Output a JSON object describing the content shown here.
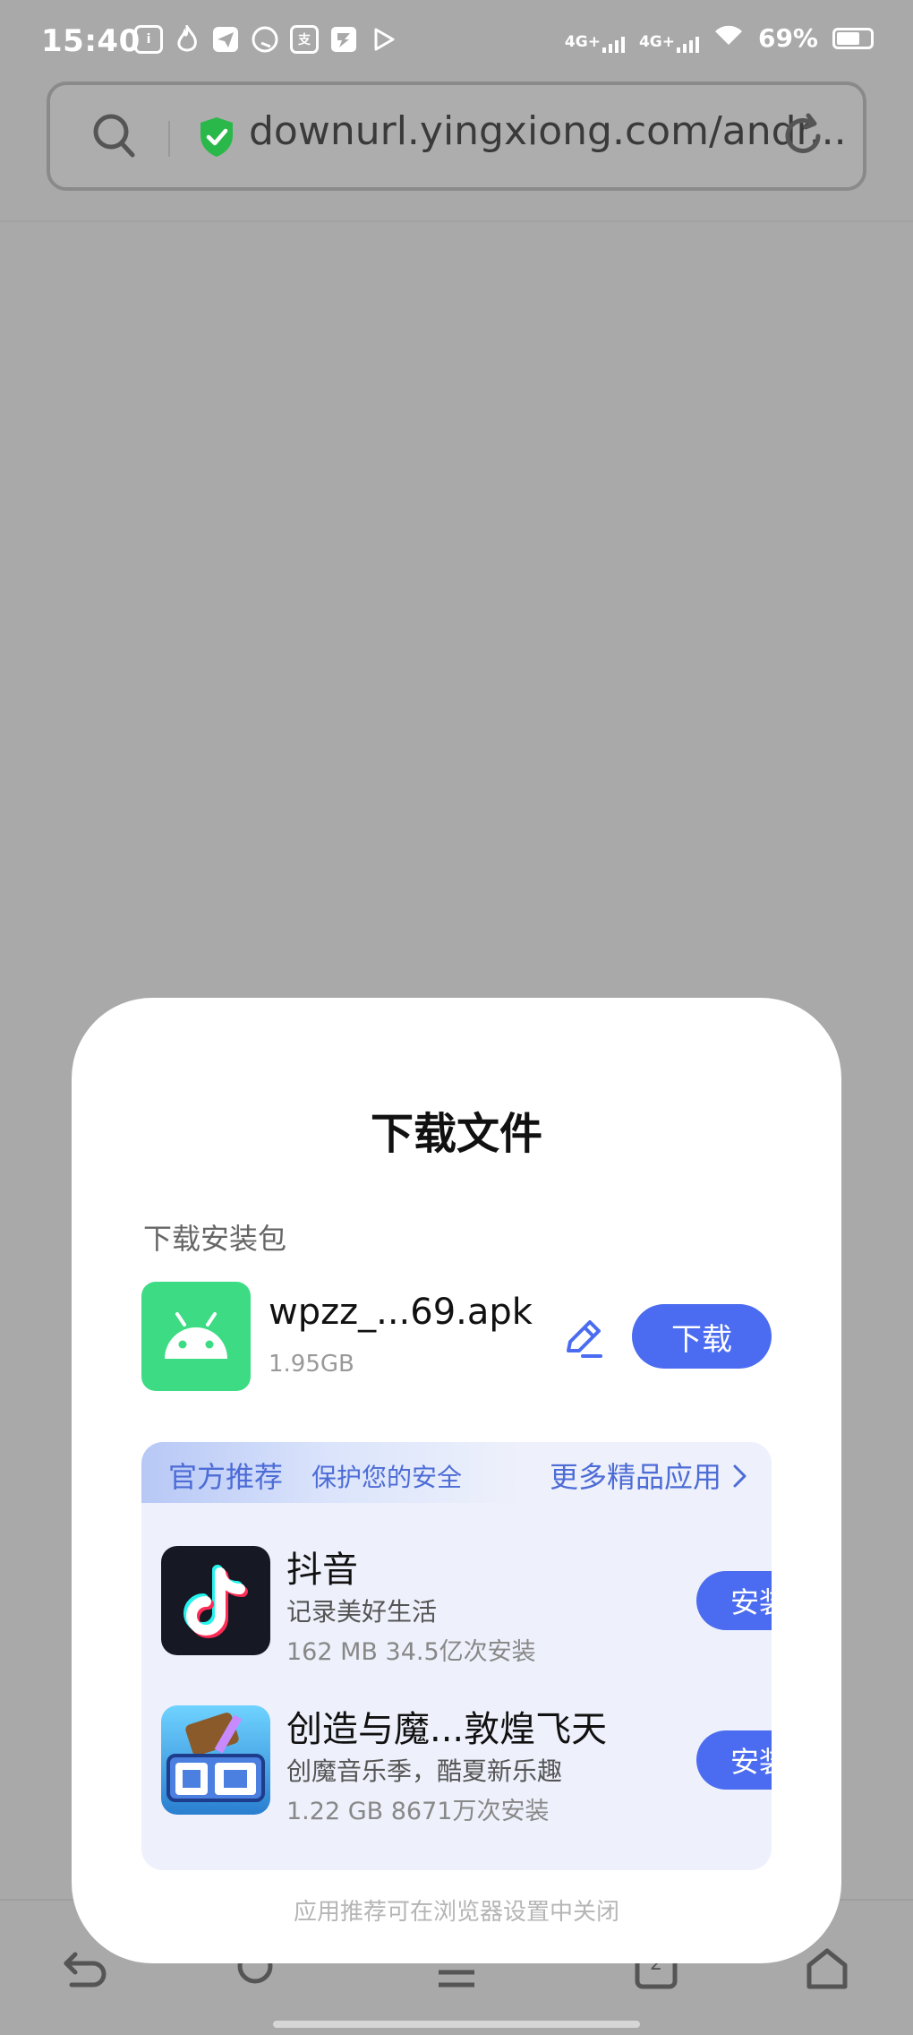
{
  "status_bar": {
    "time": "15:40",
    "app_icons": [
      "iqiyi-icon",
      "fire-icon",
      "paper-plane-icon",
      "qq-icon",
      "alipay-icon",
      "game-icon",
      "play-icon"
    ],
    "network_1": "4G+",
    "network_2": "4G+",
    "battery": "69%"
  },
  "address_bar": {
    "url": "downurl.yingxiong.com/andr..."
  },
  "dialog": {
    "title": "下载文件",
    "section_label": "下载安装包",
    "file": {
      "name": "wpzz_...69.apk",
      "size": "1.95GB",
      "download_label": "下载"
    },
    "recommend": {
      "official": "官方推荐",
      "safe": "保护您的安全",
      "more": "更多精品应用",
      "apps": [
        {
          "name": "抖音",
          "desc": "记录美好生活",
          "meta": "162 MB  34.5亿次安装",
          "install_label": "安装",
          "icon": "douyin-icon"
        },
        {
          "name": "创造与魔...敦煌飞天",
          "desc": "创魔音乐季，酷夏新乐趣",
          "meta": "1.22 GB  8671万次安装",
          "install_label": "安装",
          "icon": "creation-magic-icon"
        }
      ]
    },
    "footer": "应用推荐可在浏览器设置中关闭"
  },
  "bottom_nav": {
    "tab_count": "2"
  },
  "colors": {
    "accent": "#4b6cf0",
    "android_green": "#3ddc84",
    "scrim": "#a9a9a9"
  }
}
